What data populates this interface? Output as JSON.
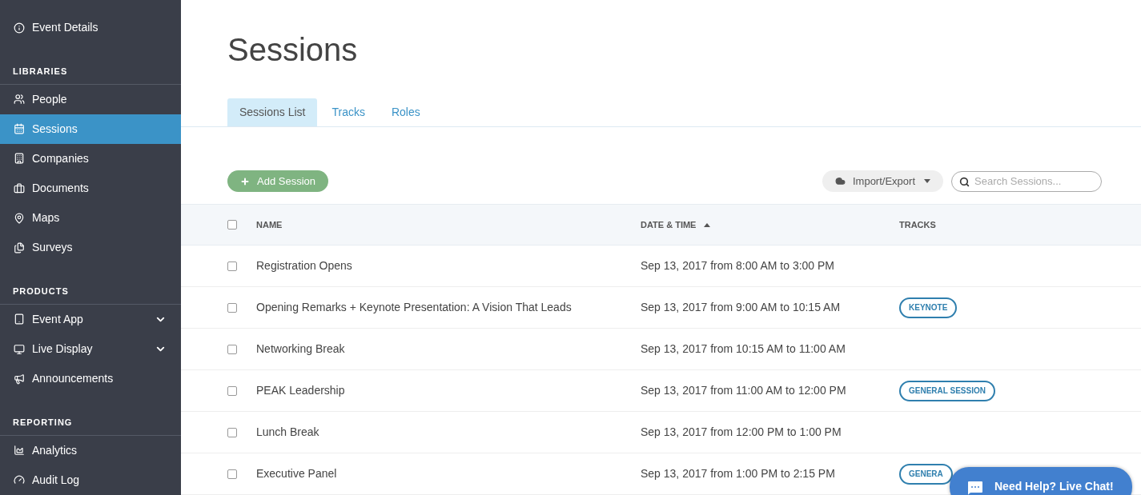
{
  "sidebar": {
    "items": [
      {
        "kind": "link",
        "label": "Event Details",
        "selected": false,
        "has_submenu": false
      },
      {
        "kind": "heading",
        "label": "LIBRARIES"
      },
      {
        "kind": "link",
        "label": "People",
        "selected": false,
        "has_submenu": false
      },
      {
        "kind": "link",
        "label": "Sessions",
        "selected": true,
        "has_submenu": false
      },
      {
        "kind": "link",
        "label": "Companies",
        "selected": false,
        "has_submenu": false
      },
      {
        "kind": "link",
        "label": "Documents",
        "selected": false,
        "has_submenu": false
      },
      {
        "kind": "link",
        "label": "Maps",
        "selected": false,
        "has_submenu": false
      },
      {
        "kind": "link",
        "label": "Surveys",
        "selected": false,
        "has_submenu": false
      },
      {
        "kind": "heading",
        "label": "PRODUCTS"
      },
      {
        "kind": "link",
        "label": "Event App",
        "selected": false,
        "has_submenu": true
      },
      {
        "kind": "link",
        "label": "Live Display",
        "selected": false,
        "has_submenu": true
      },
      {
        "kind": "link",
        "label": "Announcements",
        "selected": false,
        "has_submenu": false
      },
      {
        "kind": "heading",
        "label": "REPORTING"
      },
      {
        "kind": "link",
        "label": "Analytics",
        "selected": false,
        "has_submenu": false
      },
      {
        "kind": "link",
        "label": "Audit Log",
        "selected": false,
        "has_submenu": false
      }
    ]
  },
  "page_title": "Sessions",
  "tabs": [
    {
      "label": "Sessions List",
      "selected": true
    },
    {
      "label": "Tracks",
      "selected": false
    },
    {
      "label": "Roles",
      "selected": false
    }
  ],
  "add_button": "Add Session",
  "import_button": "Import/Export",
  "search": {
    "placeholder": "Search Sessions..."
  },
  "table": {
    "select_all_checked": false,
    "columns": [
      {
        "label": "NAME",
        "sorted_ascending": false
      },
      {
        "label": "DATE & TIME",
        "sorted_ascending": true
      },
      {
        "label": "TRACKS",
        "sorted_ascending": false
      }
    ],
    "rows": [
      {
        "checked": false,
        "name": "Registration Opens",
        "datetime": "Sep 13, 2017 from 8:00 AM to 3:00 PM",
        "tracks": []
      },
      {
        "checked": false,
        "name": "Opening Remarks + Keynote Presentation: A Vision That Leads",
        "datetime": "Sep 13, 2017 from 9:00 AM to 10:15 AM",
        "tracks": [
          "KEYNOTE"
        ]
      },
      {
        "checked": false,
        "name": "Networking Break",
        "datetime": "Sep 13, 2017 from 10:15 AM to 11:00 AM",
        "tracks": []
      },
      {
        "checked": false,
        "name": "PEAK Leadership",
        "datetime": "Sep 13, 2017 from 11:00 AM to 12:00 PM",
        "tracks": [
          "GENERAL SESSION"
        ]
      },
      {
        "checked": false,
        "name": "Lunch Break",
        "datetime": "Sep 13, 2017 from 12:00 PM to 1:00 PM",
        "tracks": []
      },
      {
        "checked": false,
        "name": "Executive Panel",
        "datetime": "Sep 13, 2017 from 1:00 PM to 2:15 PM",
        "tracks": [
          "GENERA"
        ]
      }
    ]
  },
  "chat_button": "Need Help? Live Chat!"
}
